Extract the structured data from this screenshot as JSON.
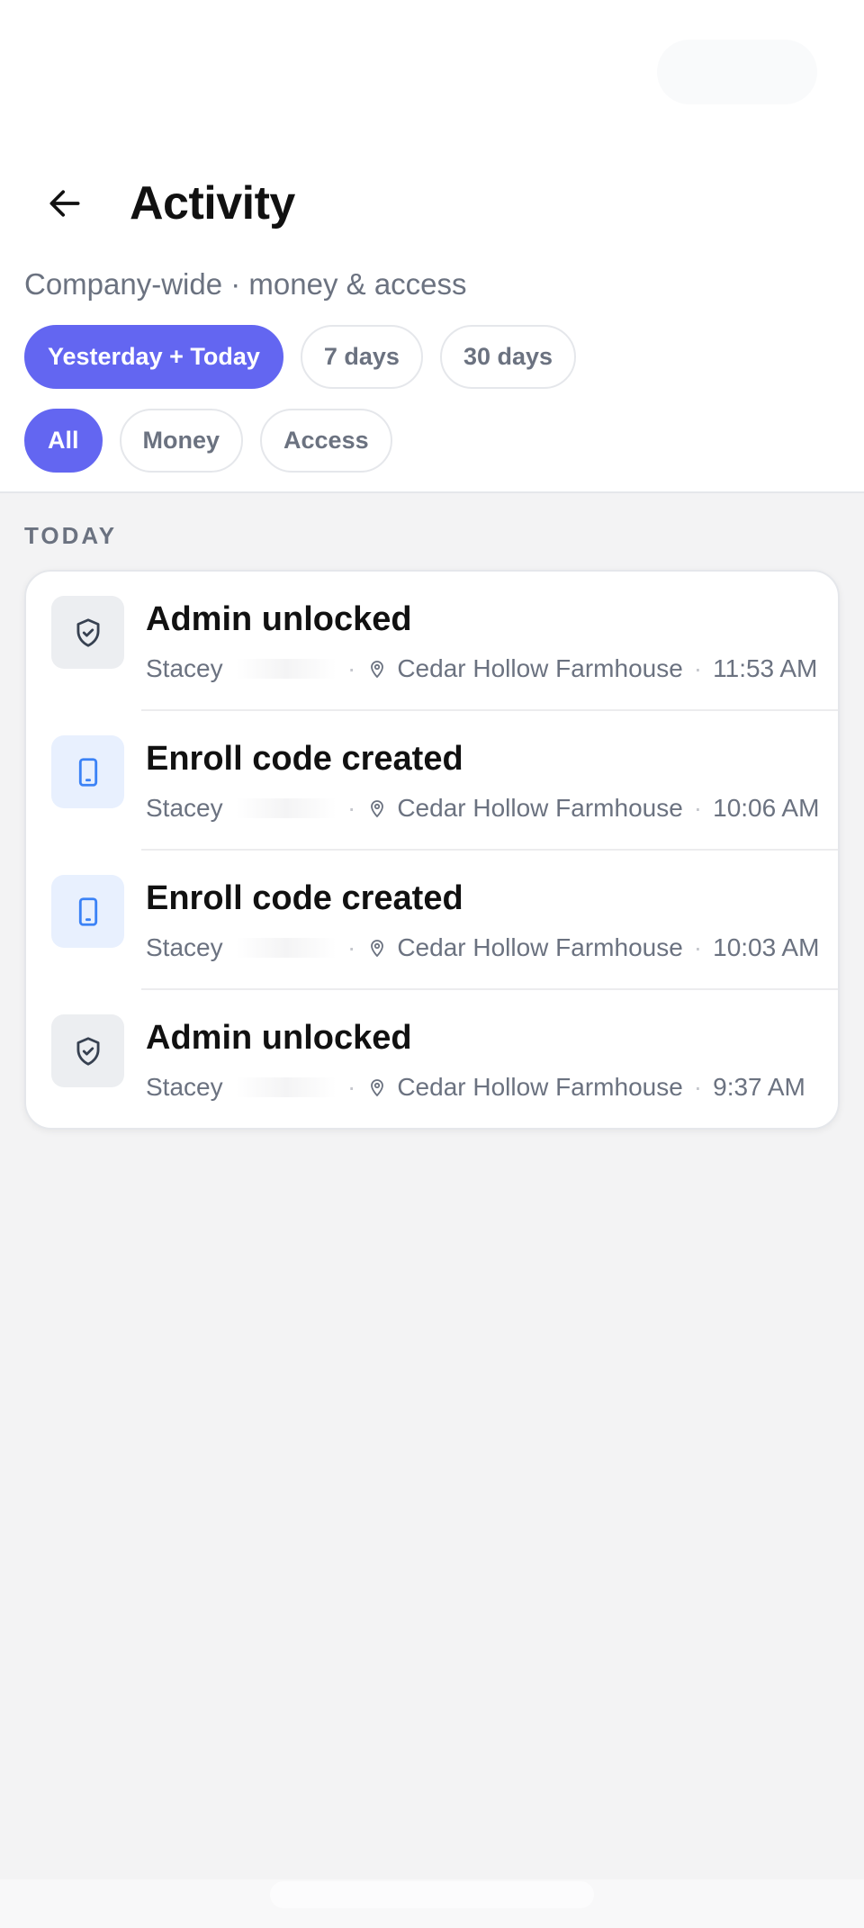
{
  "header": {
    "title": "Activity",
    "subtitle": "Company-wide · money & access"
  },
  "range_filters": [
    {
      "label": "Yesterday + Today",
      "active": true
    },
    {
      "label": "7 days",
      "active": false
    },
    {
      "label": "30 days",
      "active": false
    }
  ],
  "type_filters": [
    {
      "label": "All",
      "active": true
    },
    {
      "label": "Money",
      "active": false
    },
    {
      "label": "Access",
      "active": false
    }
  ],
  "section": {
    "label": "TODAY"
  },
  "events": [
    {
      "title": "Admin unlocked",
      "user": "Stacey",
      "location": "Cedar Hollow Farmhouse",
      "time": "11:53 AM",
      "icon": "shield-check-icon"
    },
    {
      "title": "Enroll code created",
      "user": "Stacey",
      "location": "Cedar Hollow Farmhouse",
      "time": "10:06 AM",
      "icon": "tablet-icon"
    },
    {
      "title": "Enroll code created",
      "user": "Stacey",
      "location": "Cedar Hollow Farmhouse",
      "time": "10:03 AM",
      "icon": "tablet-icon"
    },
    {
      "title": "Admin unlocked",
      "user": "Stacey",
      "location": "Cedar Hollow Farmhouse",
      "time": "9:37 AM",
      "icon": "shield-check-icon"
    }
  ],
  "colors": {
    "accent": "#6366f1",
    "muted_text": "#6b7280",
    "background": "#f3f3f4"
  }
}
